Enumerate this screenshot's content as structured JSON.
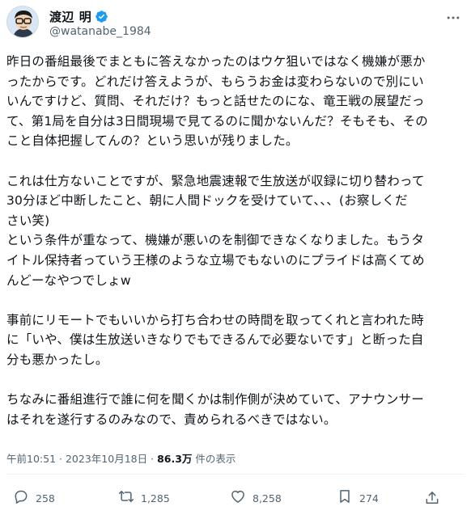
{
  "author": {
    "display_name": "渡辺 明",
    "handle": "@watanabe_1984"
  },
  "post": {
    "lines": [
      "昨日の番組最後でまともに答えなかったのはウケ狙いではなく機嫌が悪か",
      "ったからです。どれだけ答えようが、もらうお金は変わらないので別にい",
      "いんですけど、質問、それだけ？もっと話せたのにな、竜王戦の展望だっ",
      "て、第1局を自分は3日間現場で見てるのに聞かないんだ？そもそも、その",
      "こと自体把握してんの？という思いが残りました。",
      "",
      "これは仕方ないことですが、緊急地震速報で生放送が収録に切り替わって",
      "30分ほど中断したこと、朝に人間ドックを受けていて、、、(お察しくだ",
      "さい笑)",
      "という条件が重なって、機嫌が悪いのを制御できなくなりました。もうタ",
      "イトル保持者っていう王様のような立場でもないのにプライドは高くてめ",
      "んどーなやつでしょw",
      "",
      "事前にリモートでもいいから打ち合わせの時間を取ってくれと言われた時",
      "に「いや、僕は生放送いきなりでもできるんで必要ないです」と断った自",
      "分も悪かったし。",
      "",
      "ちなみに番組進行で誰に何を聞くかは制作側が決めていて、アナウンサー",
      "はそれを遂行するのみなので、責められるべきではない。"
    ],
    "time": "午前10:51",
    "separator": "·",
    "date": "2023年10月18日",
    "views_count": "86.3万",
    "views_label": "件の表示"
  },
  "actions": {
    "replies": "258",
    "reposts": "1,285",
    "likes": "8,258",
    "bookmarks": "274"
  },
  "colors": {
    "accent": "#1d9bf0",
    "text": "#0f1419",
    "secondary": "#536471"
  },
  "icons": [
    "avatar",
    "verified-badge-icon",
    "more-icon",
    "reply-icon",
    "repost-icon",
    "like-icon",
    "bookmark-icon",
    "share-icon"
  ]
}
